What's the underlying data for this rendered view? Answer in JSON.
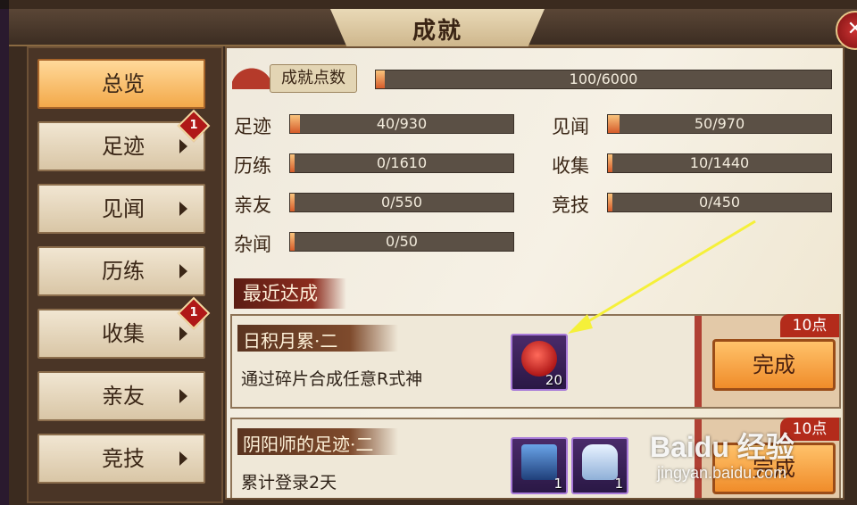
{
  "window": {
    "title": "成就"
  },
  "sidebar": {
    "items": [
      {
        "label": "总览",
        "active": true,
        "badge": ""
      },
      {
        "label": "足迹",
        "active": false,
        "badge": "1"
      },
      {
        "label": "见闻",
        "active": false,
        "badge": ""
      },
      {
        "label": "历练",
        "active": false,
        "badge": ""
      },
      {
        "label": "收集",
        "active": false,
        "badge": "1"
      },
      {
        "label": "亲友",
        "active": false,
        "badge": ""
      },
      {
        "label": "竞技",
        "active": false,
        "badge": ""
      }
    ]
  },
  "overview": {
    "total": {
      "label": "成就点数",
      "value": "100/6000",
      "fraction": 0.0167
    },
    "stats": [
      {
        "label": "足迹",
        "value": "40/930",
        "fraction": 0.043
      },
      {
        "label": "见闻",
        "value": "50/970",
        "fraction": 0.052
      },
      {
        "label": "历练",
        "value": "0/1610",
        "fraction": 0
      },
      {
        "label": "收集",
        "value": "10/1440",
        "fraction": 0.007
      },
      {
        "label": "亲友",
        "value": "0/550",
        "fraction": 0
      },
      {
        "label": "竞技",
        "value": "0/450",
        "fraction": 0
      },
      {
        "label": "杂闻",
        "value": "0/50",
        "fraction": 0
      }
    ]
  },
  "recent": {
    "title": "最近达成",
    "cards": [
      {
        "name": "日积月累·二",
        "desc": "通过碎片合成任意R式神",
        "points": "10点",
        "button": "完成",
        "rewards": [
          {
            "icon": "red-daruma-icon",
            "count": "20"
          }
        ]
      },
      {
        "name": "阴阳师的足迹·二",
        "desc": "累计登录2天",
        "points": "10点",
        "button": "完成",
        "rewards": [
          {
            "icon": "blue-ticket-icon",
            "count": "1"
          },
          {
            "icon": "sake-bottles-icon",
            "count": "1"
          }
        ]
      }
    ]
  },
  "watermark": {
    "top": "Baidu 经验",
    "bottom": "jingyan.baidu.com"
  },
  "colors": {
    "accent": "#f08c2a",
    "badge": "#b01818",
    "bar": "#5b5045"
  }
}
